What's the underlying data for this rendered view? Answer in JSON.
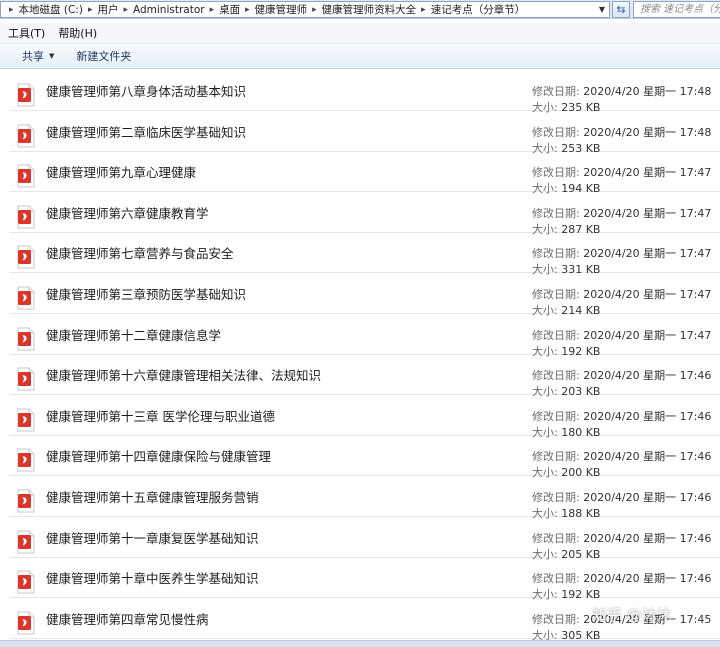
{
  "address_bar": {
    "breadcrumbs": [
      "本地磁盘 (C:)",
      "用户",
      "Administrator",
      "桌面",
      "健康管理师",
      "健康管理师资料大全",
      "速记考点（分章节）"
    ],
    "search_placeholder": "搜索 速记考点（分章节）"
  },
  "menu": {
    "items": [
      "工具(T)",
      "帮助(H)"
    ]
  },
  "toolbar": {
    "share_label": "共享",
    "new_folder_label": "新建文件夹"
  },
  "labels": {
    "modified": "修改日期:",
    "size": "大小:"
  },
  "files": [
    {
      "name": "健康管理师第八章身体活动基本知识",
      "modified": "2020/4/20 星期一 17:48",
      "size": "235 KB"
    },
    {
      "name": "健康管理师第二章临床医学基础知识",
      "modified": "2020/4/20 星期一 17:48",
      "size": "253 KB"
    },
    {
      "name": "健康管理师第九章心理健康",
      "modified": "2020/4/20 星期一 17:47",
      "size": "194 KB"
    },
    {
      "name": "健康管理师第六章健康教育学",
      "modified": "2020/4/20 星期一 17:47",
      "size": "287 KB"
    },
    {
      "name": "健康管理师第七章营养与食品安全",
      "modified": "2020/4/20 星期一 17:47",
      "size": "331 KB"
    },
    {
      "name": "健康管理师第三章预防医学基础知识",
      "modified": "2020/4/20 星期一 17:47",
      "size": "214 KB"
    },
    {
      "name": "健康管理师第十二章健康信息学",
      "modified": "2020/4/20 星期一 17:47",
      "size": "192 KB"
    },
    {
      "name": "健康管理师第十六章健康管理相关法律、法规知识",
      "modified": "2020/4/20 星期一 17:46",
      "size": "203 KB"
    },
    {
      "name": "健康管理师第十三章 医学伦理与职业道德",
      "modified": "2020/4/20 星期一 17:46",
      "size": "180 KB"
    },
    {
      "name": "健康管理师第十四章健康保险与健康管理",
      "modified": "2020/4/20 星期一 17:46",
      "size": "200 KB"
    },
    {
      "name": "健康管理师第十五章健康管理服务营销",
      "modified": "2020/4/20 星期一 17:46",
      "size": "188 KB"
    },
    {
      "name": "健康管理师第十一章康复医学基础知识",
      "modified": "2020/4/20 星期一 17:46",
      "size": "205 KB"
    },
    {
      "name": "健康管理师第十章中医养生学基础知识",
      "modified": "2020/4/20 星期一 17:46",
      "size": "192 KB"
    },
    {
      "name": "健康管理师第四章常见慢性病",
      "modified": "2020/4/20 星期一 17:45",
      "size": "305 KB"
    }
  ],
  "watermark": "知乎 @沐沐",
  "icons": {
    "file": "pdf-file-icon",
    "refresh": "refresh-icon",
    "dropdown": "chevron-down-icon"
  },
  "colors": {
    "pdf_red": "#d9372b",
    "frame_blue": "#dfe9f5"
  }
}
